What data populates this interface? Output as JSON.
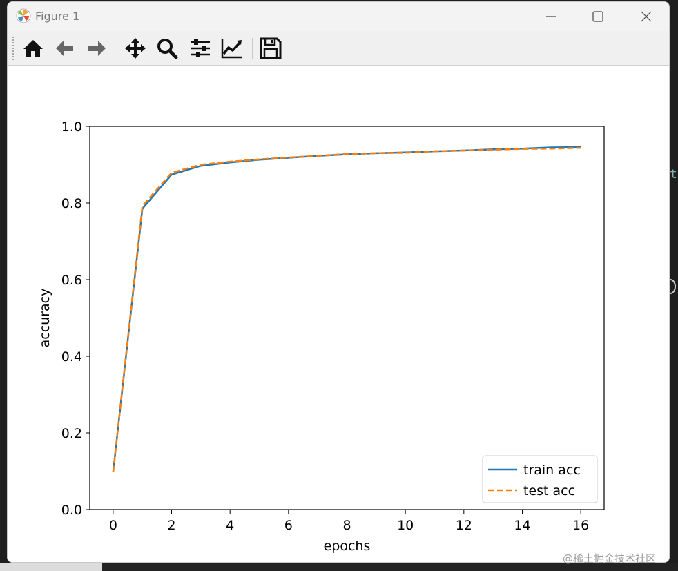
{
  "window": {
    "title": "Figure 1",
    "app_icon": "matplotlib-logo-icon",
    "controls": [
      "minimize-icon",
      "maximize-icon",
      "close-icon"
    ]
  },
  "toolbar": {
    "tools": [
      "home-icon",
      "back-icon",
      "forward-icon",
      "pan-icon",
      "zoom-icon",
      "configure-subplots-icon",
      "edit-axis-icon",
      "save-icon"
    ]
  },
  "watermark": "@稀土掘金技术社区",
  "colors": {
    "train": "#1f77b4",
    "test": "#ff7f0e"
  },
  "chart_data": {
    "type": "line",
    "title": "",
    "xlabel": "epochs",
    "ylabel": "accuracy",
    "xlim": [
      -0.8,
      16.8
    ],
    "ylim": [
      0.0,
      1.0
    ],
    "xticks": [
      0,
      2,
      4,
      6,
      8,
      10,
      12,
      14,
      16
    ],
    "yticks": [
      0.0,
      0.2,
      0.4,
      0.6,
      0.8,
      1.0
    ],
    "grid": false,
    "legend_position": "lower right",
    "x": [
      0,
      1,
      2,
      3,
      4,
      5,
      6,
      7,
      8,
      9,
      10,
      11,
      12,
      13,
      14,
      15,
      16
    ],
    "series": [
      {
        "name": "train acc",
        "style": "solid",
        "values": [
          0.098,
          0.785,
          0.874,
          0.897,
          0.906,
          0.913,
          0.918,
          0.923,
          0.927,
          0.93,
          0.932,
          0.935,
          0.937,
          0.94,
          0.942,
          0.945,
          0.946
        ]
      },
      {
        "name": "test acc",
        "style": "dashed",
        "values": [
          0.098,
          0.792,
          0.879,
          0.9,
          0.908,
          0.914,
          0.919,
          0.923,
          0.928,
          0.93,
          0.931,
          0.935,
          0.937,
          0.939,
          0.941,
          0.942,
          0.944
        ]
      }
    ]
  }
}
